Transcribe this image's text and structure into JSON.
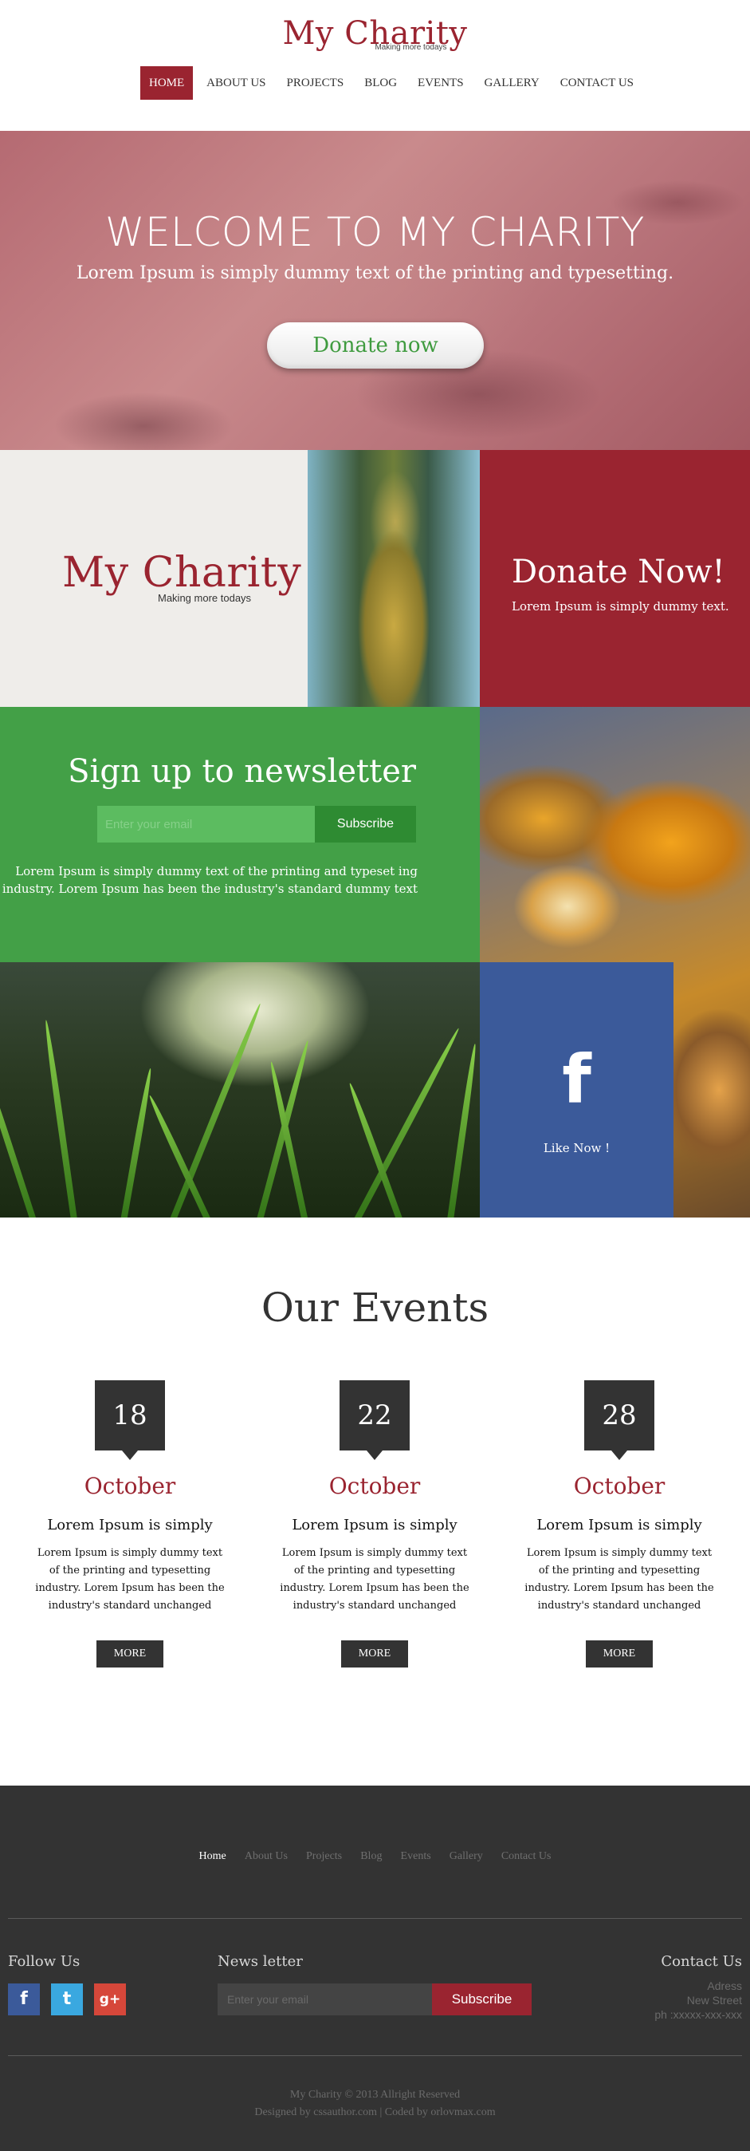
{
  "brand": {
    "name": "My Charity",
    "tagline": "Making more todays",
    "accent": "#9a2430",
    "green": "#43a047",
    "facebook": "#3b5a9a"
  },
  "nav": {
    "items": [
      "HOME",
      "ABOUT US",
      "PROJECTS",
      "BLOG",
      "EVENTS",
      "GALLERY",
      "CONTACT US"
    ],
    "active": "HOME"
  },
  "hero": {
    "title": "WELCOME TO MY CHARITY",
    "subtitle": "Lorem Ipsum is simply dummy text of the printing and typesetting.",
    "button": "Donate now"
  },
  "donate_tile": {
    "title": "Donate Now!",
    "text": "Lorem Ipsum is simply dummy text."
  },
  "newsletter": {
    "title": "Sign up to newsletter",
    "placeholder": "Enter your email",
    "button": "Subscribe",
    "text": "Lorem Ipsum is simply dummy text of the printing and typeset ing industry. Lorem Ipsum has been the industry's standard dummy text"
  },
  "facebook": {
    "icon": "facebook-icon",
    "glyph": "f",
    "label": "Like Now !"
  },
  "events": {
    "title": "Our Events",
    "items": [
      {
        "day": "18",
        "month": "October",
        "heading": "Lorem Ipsum is simply",
        "text": "Lorem Ipsum is simply dummy text of the printing and typesetting industry. Lorem Ipsum has been the industry's standard unchanged",
        "more": "MORE"
      },
      {
        "day": "22",
        "month": "October",
        "heading": "Lorem Ipsum is simply",
        "text": "Lorem Ipsum is simply dummy text of the printing and typesetting industry. Lorem Ipsum has been the industry's standard unchanged",
        "more": "MORE"
      },
      {
        "day": "28",
        "month": "October",
        "heading": "Lorem Ipsum is simply",
        "text": "Lorem Ipsum is simply dummy text of the printing and typesetting industry. Lorem Ipsum has been the industry's standard unchanged",
        "more": "MORE"
      }
    ]
  },
  "footer": {
    "nav": [
      "Home",
      "About Us",
      "Projects",
      "Blog",
      "Events",
      "Gallery",
      "Contact Us"
    ],
    "nav_active": "Home",
    "follow_title": "Follow Us",
    "social": [
      {
        "icon": "facebook-icon",
        "glyph": "f",
        "color": "#3b5a9a"
      },
      {
        "icon": "twitter-icon",
        "glyph": "t",
        "color": "#3aa8e0"
      },
      {
        "icon": "google-plus-icon",
        "glyph": "g+",
        "color": "#d6473a"
      }
    ],
    "newsletter_title": "News letter",
    "newsletter_placeholder": "Enter your email",
    "newsletter_button": "Subscribe",
    "contact_title": "Contact Us",
    "contact_lines": [
      "Adress",
      "New Street",
      "ph :xxxxx-xxx-xxx"
    ],
    "copyright": "My Charity © 2013 Allright Reserved",
    "credits": "Designed by cssauthor.com | Coded by orlovmax.com"
  }
}
